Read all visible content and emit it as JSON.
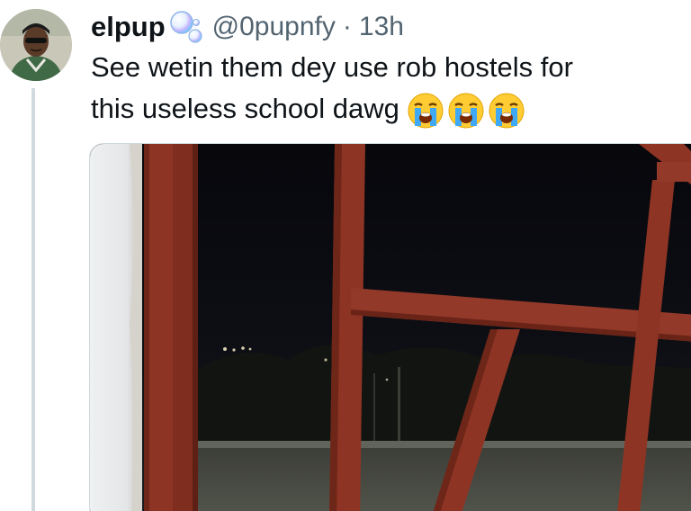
{
  "tweet": {
    "display_name": "elpup",
    "handle": "@0pupnfy",
    "separator": "·",
    "time": "13h",
    "name_emoji_icon": "soap-bubbles-icon",
    "text_line1": "See wetin them dey use rob hostels for",
    "text_line2": "this useless school dawg",
    "text_emojis": [
      "loudly-crying-face-icon",
      "loudly-crying-face-icon",
      "loudly-crying-face-icon"
    ]
  },
  "media": {
    "kind": "photo",
    "subject_icon": "broken-window-frame-photo"
  },
  "colors": {
    "text_primary": "#0f1419",
    "text_secondary": "#536471",
    "thread_line": "#cfd9de",
    "frame_red": "#8e3424",
    "night_sky": "#0b0b10"
  }
}
